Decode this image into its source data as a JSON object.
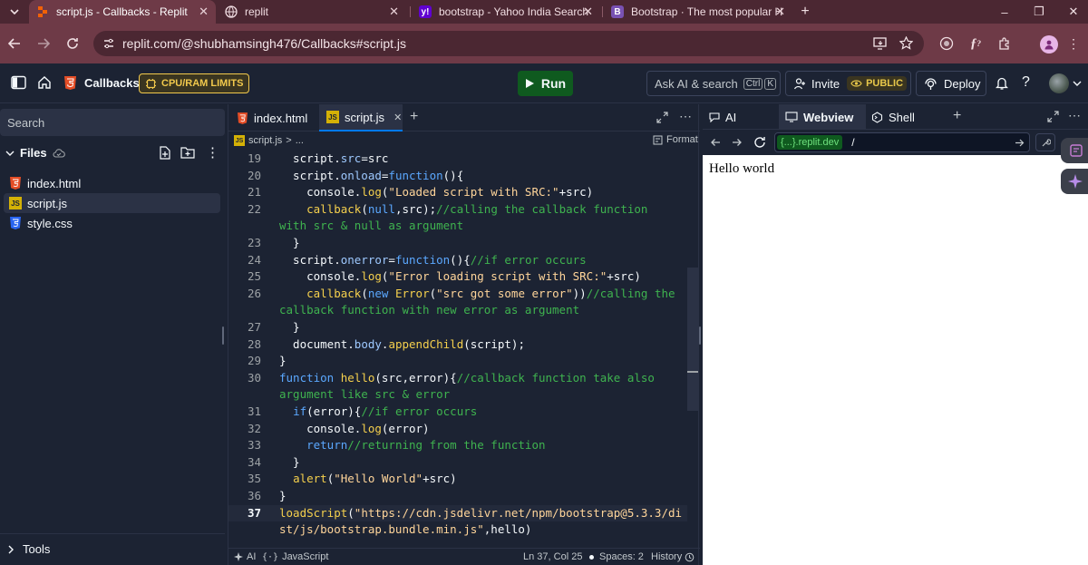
{
  "browser": {
    "tabs": [
      {
        "title": "script.js - Callbacks - Replit",
        "active": true
      },
      {
        "title": "replit",
        "active": false
      },
      {
        "title": "bootstrap - Yahoo India Search",
        "active": false
      },
      {
        "title": "Bootstrap · The most popular H",
        "active": false
      }
    ],
    "favicon_letters": {
      "yahoo": "y!",
      "bootstrap": "B"
    },
    "new_tab": "+",
    "url": "replit.com/@shubhamsingh476/Callbacks#script.js",
    "window_controls": {
      "minimize": "–",
      "restore": "❐",
      "close": "✕"
    }
  },
  "header": {
    "repl_name": "Callbacks",
    "limits_badge": "CPU/RAM LIMITS",
    "run_label": "Run",
    "search_label": "Ask AI & search",
    "shortcut_keys": [
      "Ctrl",
      "K"
    ],
    "invite_label": "Invite",
    "public_badge": "PUBLIC",
    "deploy_label": "Deploy"
  },
  "sidebar": {
    "search_placeholder": "Search",
    "files_title": "Files",
    "files": [
      {
        "name": "index.html",
        "type": "html",
        "selected": false
      },
      {
        "name": "script.js",
        "type": "js",
        "selected": true
      },
      {
        "name": "style.css",
        "type": "css",
        "selected": false
      }
    ],
    "tools_label": "Tools"
  },
  "editor": {
    "tabs": [
      {
        "label": "index.html",
        "active": false
      },
      {
        "label": "script.js",
        "active": true
      }
    ],
    "breadcrumb_file": "script.js",
    "breadcrumb_sep": ">",
    "breadcrumb_more": "...",
    "format_label": "Format",
    "current_line": "37",
    "lines": [
      {
        "n": "19",
        "tokens": [
          [
            "nm",
            "  script."
          ],
          [
            "pr",
            "src"
          ],
          [
            "nm",
            "=src"
          ]
        ]
      },
      {
        "n": "20",
        "tokens": [
          [
            "nm",
            "  script."
          ],
          [
            "pr",
            "onload"
          ],
          [
            "nm",
            "="
          ],
          [
            "kw",
            "function"
          ],
          [
            "nm",
            "(){"
          ]
        ]
      },
      {
        "n": "21",
        "tokens": [
          [
            "nm",
            "    console."
          ],
          [
            "fn",
            "log"
          ],
          [
            "nm",
            "("
          ],
          [
            "st",
            "\"Loaded script with SRC:\""
          ],
          [
            "nm",
            "+src)"
          ]
        ]
      },
      {
        "n": "22",
        "tokens": [
          [
            "nm",
            "    "
          ],
          [
            "fn",
            "callback"
          ],
          [
            "nm",
            "("
          ],
          [
            "kw",
            "null"
          ],
          [
            "nm",
            ",src);"
          ],
          [
            "cm",
            "//calling the callback function"
          ]
        ]
      },
      {
        "n": "",
        "tokens": [
          [
            "cm",
            "with src & null as argument"
          ]
        ]
      },
      {
        "n": "23",
        "tokens": [
          [
            "nm",
            "  }"
          ]
        ]
      },
      {
        "n": "24",
        "tokens": [
          [
            "nm",
            "  script."
          ],
          [
            "pr",
            "onerror"
          ],
          [
            "nm",
            "="
          ],
          [
            "kw",
            "function"
          ],
          [
            "nm",
            "(){"
          ],
          [
            "cm",
            "//if error occurs"
          ]
        ]
      },
      {
        "n": "25",
        "tokens": [
          [
            "nm",
            "    console."
          ],
          [
            "fn",
            "log"
          ],
          [
            "nm",
            "("
          ],
          [
            "st",
            "\"Error loading script with SRC:\""
          ],
          [
            "nm",
            "+src)"
          ]
        ]
      },
      {
        "n": "26",
        "tokens": [
          [
            "nm",
            "    "
          ],
          [
            "fn",
            "callback"
          ],
          [
            "nm",
            "("
          ],
          [
            "kw",
            "new"
          ],
          [
            "nm",
            " "
          ],
          [
            "fn",
            "Error"
          ],
          [
            "nm",
            "("
          ],
          [
            "st",
            "\"src got some error\""
          ],
          [
            "nm",
            "))"
          ],
          [
            "cm",
            "//calling the"
          ]
        ]
      },
      {
        "n": "",
        "tokens": [
          [
            "cm",
            "callback function with new error as argument"
          ]
        ]
      },
      {
        "n": "27",
        "tokens": [
          [
            "nm",
            "  }"
          ]
        ]
      },
      {
        "n": "28",
        "tokens": [
          [
            "nm",
            "  document."
          ],
          [
            "pr",
            "body"
          ],
          [
            "nm",
            "."
          ],
          [
            "fn",
            "appendChild"
          ],
          [
            "nm",
            "(script);"
          ]
        ]
      },
      {
        "n": "29",
        "tokens": [
          [
            "nm",
            "}"
          ]
        ]
      },
      {
        "n": "30",
        "tokens": [
          [
            "kw",
            "function"
          ],
          [
            "nm",
            " "
          ],
          [
            "fn",
            "hello"
          ],
          [
            "nm",
            "(src,error){"
          ],
          [
            "cm",
            "//callback function take also"
          ]
        ]
      },
      {
        "n": "",
        "tokens": [
          [
            "cm",
            "argument like src & error"
          ]
        ]
      },
      {
        "n": "31",
        "tokens": [
          [
            "nm",
            "  "
          ],
          [
            "kw",
            "if"
          ],
          [
            "nm",
            "(error){"
          ],
          [
            "cm",
            "//if error occurs"
          ]
        ]
      },
      {
        "n": "32",
        "tokens": [
          [
            "nm",
            "    console."
          ],
          [
            "fn",
            "log"
          ],
          [
            "nm",
            "(error)"
          ]
        ]
      },
      {
        "n": "33",
        "tokens": [
          [
            "nm",
            "    "
          ],
          [
            "kw",
            "return"
          ],
          [
            "cm",
            "//returning from the function"
          ]
        ]
      },
      {
        "n": "34",
        "tokens": [
          [
            "nm",
            "  }"
          ]
        ]
      },
      {
        "n": "35",
        "tokens": [
          [
            "nm",
            "  "
          ],
          [
            "fn",
            "alert"
          ],
          [
            "nm",
            "("
          ],
          [
            "st",
            "\"Hello World\""
          ],
          [
            "nm",
            "+src)"
          ]
        ]
      },
      {
        "n": "36",
        "tokens": [
          [
            "nm",
            "}"
          ]
        ]
      },
      {
        "n": "37",
        "tokens": [
          [
            "fn",
            "loadScript"
          ],
          [
            "nm",
            "("
          ],
          [
            "st",
            "\"https://cdn.jsdelivr.net/npm/bootstrap@5.3.3/di"
          ]
        ]
      },
      {
        "n": "",
        "tokens": [
          [
            "st",
            "st/js/bootstrap.bundle.min.js\""
          ],
          [
            "nm",
            ",hello)"
          ]
        ]
      }
    ],
    "status": {
      "ai_label": "AI",
      "language": "JavaScript",
      "position": "Ln 37, Col 25",
      "spaces": "Spaces: 2",
      "history": "History"
    }
  },
  "right_pane": {
    "tabs": [
      {
        "label": "AI",
        "active": false
      },
      {
        "label": "Webview",
        "active": true
      },
      {
        "label": "Shell",
        "active": false
      }
    ],
    "webview_domain": "{...}.replit.dev",
    "webview_path": "/",
    "page_text": "Hello world"
  },
  "colors": {
    "browser_frame": "#6e3a47",
    "tab_strip": "#4b2732",
    "ide_bg": "#1c2333",
    "run_button": "#0f5a1f",
    "limits_badge": "#f2c94c",
    "public_badge": "#e8c84a",
    "comment": "#3fb34f",
    "keyword": "#5ba8ff",
    "string": "#ffd59a",
    "function": "#f5d04d"
  }
}
